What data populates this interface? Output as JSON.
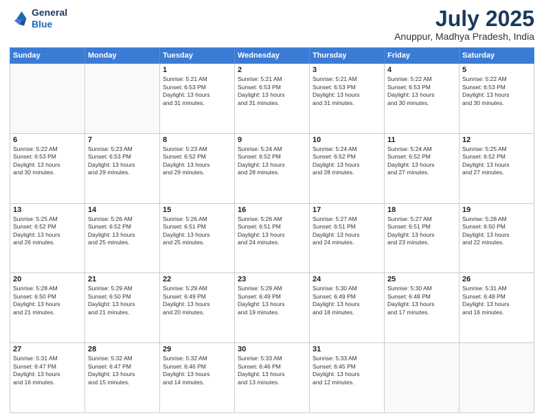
{
  "header": {
    "logo_line1": "General",
    "logo_line2": "Blue",
    "month_year": "July 2025",
    "location": "Anuppur, Madhya Pradesh, India"
  },
  "weekdays": [
    "Sunday",
    "Monday",
    "Tuesday",
    "Wednesday",
    "Thursday",
    "Friday",
    "Saturday"
  ],
  "weeks": [
    [
      {
        "day": "",
        "info": ""
      },
      {
        "day": "",
        "info": ""
      },
      {
        "day": "1",
        "info": "Sunrise: 5:21 AM\nSunset: 6:53 PM\nDaylight: 13 hours\nand 31 minutes."
      },
      {
        "day": "2",
        "info": "Sunrise: 5:21 AM\nSunset: 6:53 PM\nDaylight: 13 hours\nand 31 minutes."
      },
      {
        "day": "3",
        "info": "Sunrise: 5:21 AM\nSunset: 6:53 PM\nDaylight: 13 hours\nand 31 minutes."
      },
      {
        "day": "4",
        "info": "Sunrise: 5:22 AM\nSunset: 6:53 PM\nDaylight: 13 hours\nand 30 minutes."
      },
      {
        "day": "5",
        "info": "Sunrise: 5:22 AM\nSunset: 6:53 PM\nDaylight: 13 hours\nand 30 minutes."
      }
    ],
    [
      {
        "day": "6",
        "info": "Sunrise: 5:22 AM\nSunset: 6:53 PM\nDaylight: 13 hours\nand 30 minutes."
      },
      {
        "day": "7",
        "info": "Sunrise: 5:23 AM\nSunset: 6:53 PM\nDaylight: 13 hours\nand 29 minutes."
      },
      {
        "day": "8",
        "info": "Sunrise: 5:23 AM\nSunset: 6:52 PM\nDaylight: 13 hours\nand 29 minutes."
      },
      {
        "day": "9",
        "info": "Sunrise: 5:24 AM\nSunset: 6:52 PM\nDaylight: 13 hours\nand 28 minutes."
      },
      {
        "day": "10",
        "info": "Sunrise: 5:24 AM\nSunset: 6:52 PM\nDaylight: 13 hours\nand 28 minutes."
      },
      {
        "day": "11",
        "info": "Sunrise: 5:24 AM\nSunset: 6:52 PM\nDaylight: 13 hours\nand 27 minutes."
      },
      {
        "day": "12",
        "info": "Sunrise: 5:25 AM\nSunset: 6:52 PM\nDaylight: 13 hours\nand 27 minutes."
      }
    ],
    [
      {
        "day": "13",
        "info": "Sunrise: 5:25 AM\nSunset: 6:52 PM\nDaylight: 13 hours\nand 26 minutes."
      },
      {
        "day": "14",
        "info": "Sunrise: 5:26 AM\nSunset: 6:52 PM\nDaylight: 13 hours\nand 25 minutes."
      },
      {
        "day": "15",
        "info": "Sunrise: 5:26 AM\nSunset: 6:51 PM\nDaylight: 13 hours\nand 25 minutes."
      },
      {
        "day": "16",
        "info": "Sunrise: 5:26 AM\nSunset: 6:51 PM\nDaylight: 13 hours\nand 24 minutes."
      },
      {
        "day": "17",
        "info": "Sunrise: 5:27 AM\nSunset: 6:51 PM\nDaylight: 13 hours\nand 24 minutes."
      },
      {
        "day": "18",
        "info": "Sunrise: 5:27 AM\nSunset: 6:51 PM\nDaylight: 13 hours\nand 23 minutes."
      },
      {
        "day": "19",
        "info": "Sunrise: 5:28 AM\nSunset: 6:50 PM\nDaylight: 13 hours\nand 22 minutes."
      }
    ],
    [
      {
        "day": "20",
        "info": "Sunrise: 5:28 AM\nSunset: 6:50 PM\nDaylight: 13 hours\nand 21 minutes."
      },
      {
        "day": "21",
        "info": "Sunrise: 5:29 AM\nSunset: 6:50 PM\nDaylight: 13 hours\nand 21 minutes."
      },
      {
        "day": "22",
        "info": "Sunrise: 5:29 AM\nSunset: 6:49 PM\nDaylight: 13 hours\nand 20 minutes."
      },
      {
        "day": "23",
        "info": "Sunrise: 5:29 AM\nSunset: 6:49 PM\nDaylight: 13 hours\nand 19 minutes."
      },
      {
        "day": "24",
        "info": "Sunrise: 5:30 AM\nSunset: 6:49 PM\nDaylight: 13 hours\nand 18 minutes."
      },
      {
        "day": "25",
        "info": "Sunrise: 5:30 AM\nSunset: 6:48 PM\nDaylight: 13 hours\nand 17 minutes."
      },
      {
        "day": "26",
        "info": "Sunrise: 5:31 AM\nSunset: 6:48 PM\nDaylight: 13 hours\nand 16 minutes."
      }
    ],
    [
      {
        "day": "27",
        "info": "Sunrise: 5:31 AM\nSunset: 6:47 PM\nDaylight: 13 hours\nand 16 minutes."
      },
      {
        "day": "28",
        "info": "Sunrise: 5:32 AM\nSunset: 6:47 PM\nDaylight: 13 hours\nand 15 minutes."
      },
      {
        "day": "29",
        "info": "Sunrise: 5:32 AM\nSunset: 6:46 PM\nDaylight: 13 hours\nand 14 minutes."
      },
      {
        "day": "30",
        "info": "Sunrise: 5:33 AM\nSunset: 6:46 PM\nDaylight: 13 hours\nand 13 minutes."
      },
      {
        "day": "31",
        "info": "Sunrise: 5:33 AM\nSunset: 6:45 PM\nDaylight: 13 hours\nand 12 minutes."
      },
      {
        "day": "",
        "info": ""
      },
      {
        "day": "",
        "info": ""
      }
    ]
  ]
}
